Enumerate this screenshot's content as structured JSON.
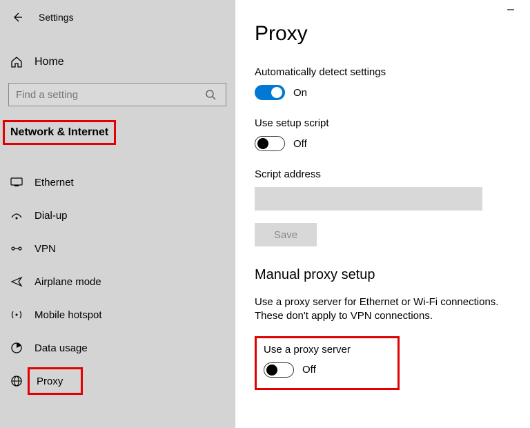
{
  "header": {
    "title": "Settings"
  },
  "sidebar": {
    "home": "Home",
    "search_placeholder": "Find a setting",
    "category": "Network & Internet",
    "items": [
      {
        "label": "Ethernet"
      },
      {
        "label": "Dial-up"
      },
      {
        "label": "VPN"
      },
      {
        "label": "Airplane mode"
      },
      {
        "label": "Mobile hotspot"
      },
      {
        "label": "Data usage"
      },
      {
        "label": "Proxy"
      }
    ]
  },
  "main": {
    "title": "Proxy",
    "auto_detect": {
      "label": "Automatically detect settings",
      "state": "On"
    },
    "setup_script": {
      "label": "Use setup script",
      "state": "Off"
    },
    "script_address_label": "Script address",
    "save_label": "Save",
    "manual_section": "Manual proxy setup",
    "manual_desc": "Use a proxy server for Ethernet or Wi-Fi connections. These don't apply to VPN connections.",
    "use_proxy": {
      "label": "Use a proxy server",
      "state": "Off"
    }
  }
}
